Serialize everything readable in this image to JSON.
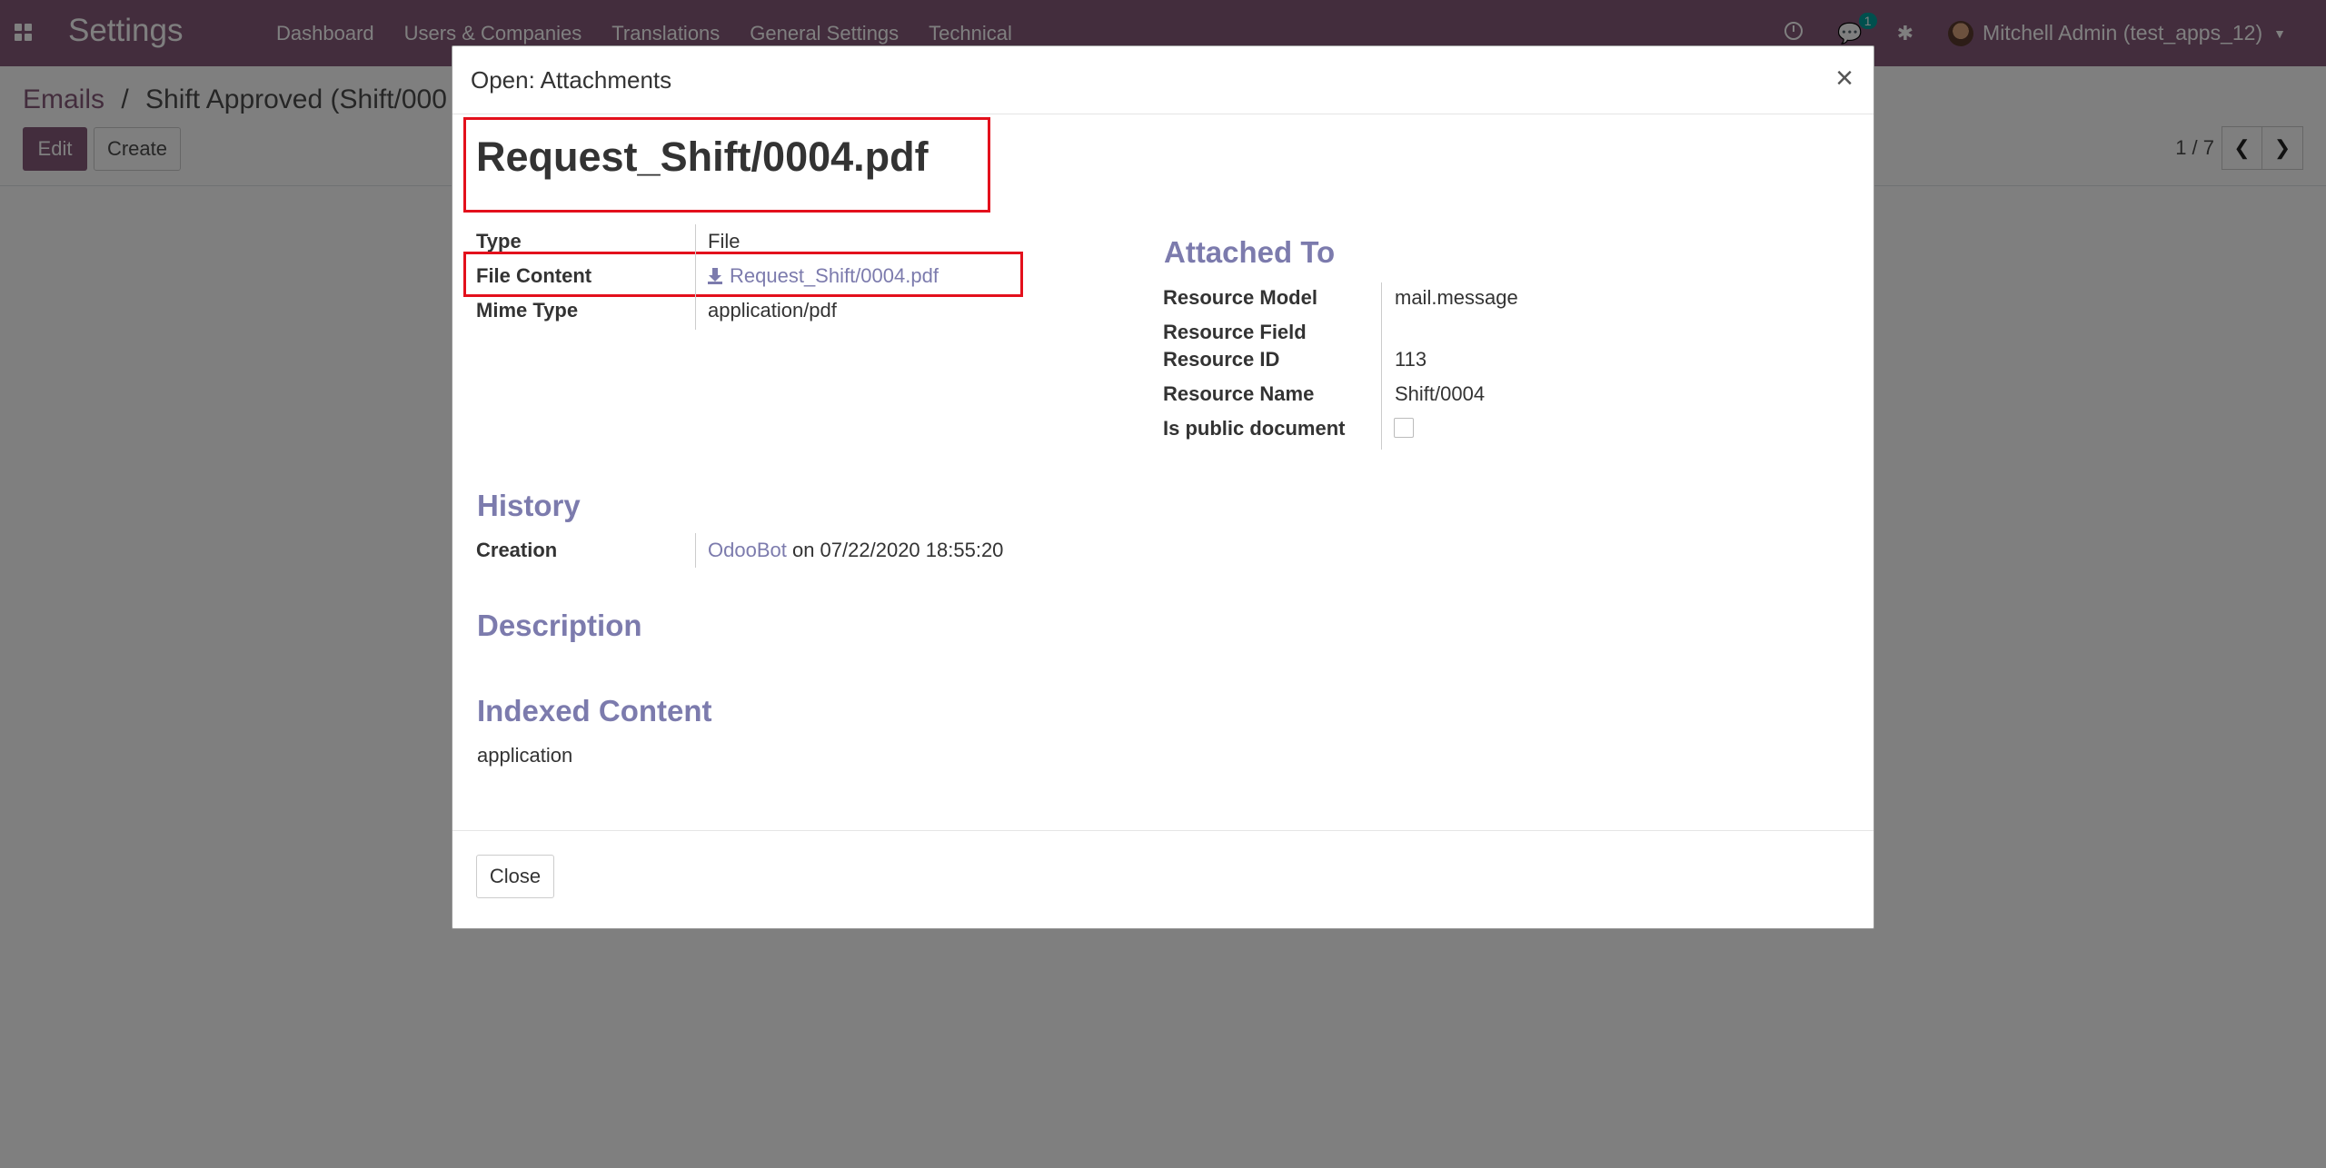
{
  "navbar": {
    "app_title": "Settings",
    "menu": [
      "Dashboard",
      "Users & Companies",
      "Translations",
      "General Settings",
      "Technical"
    ],
    "chat_badge": "1",
    "user_name": "Mitchell Admin (test_apps_12)"
  },
  "control_panel": {
    "breadcrumb_root": "Emails",
    "breadcrumb_separator": "/",
    "breadcrumb_current": "Shift Approved (Shift/000",
    "edit_label": "Edit",
    "create_label": "Create",
    "pager_value": "1 / 7"
  },
  "modal": {
    "title": "Open: Attachments",
    "close_icon": "×",
    "name": "Request_Shift/0004.pdf",
    "fields_left": [
      {
        "label": "Type",
        "value": "File"
      },
      {
        "label": "File Content",
        "value": "Request_Shift/0004.pdf"
      },
      {
        "label": "Mime Type",
        "value": "application/pdf"
      }
    ],
    "attached_to": {
      "title": "Attached To",
      "fields": [
        {
          "label": "Resource Model",
          "value": "mail.message"
        },
        {
          "label": "Resource Field",
          "value": ""
        },
        {
          "label": "Resource ID",
          "value": "113"
        },
        {
          "label": "Resource Name",
          "value": "Shift/0004"
        },
        {
          "label": "Is public document",
          "value": ""
        }
      ],
      "is_public": false
    },
    "history": {
      "title": "History",
      "creation_label": "Creation",
      "creator": "OdooBot",
      "creation_text": "on 07/22/2020 18:55:20"
    },
    "description_title": "Description",
    "indexed_content": {
      "title": "Indexed Content",
      "value": "application"
    },
    "footer_close_label": "Close"
  },
  "colors": {
    "brand": "#875a7b",
    "link": "#7c7bad",
    "highlight": "#e3101c"
  }
}
